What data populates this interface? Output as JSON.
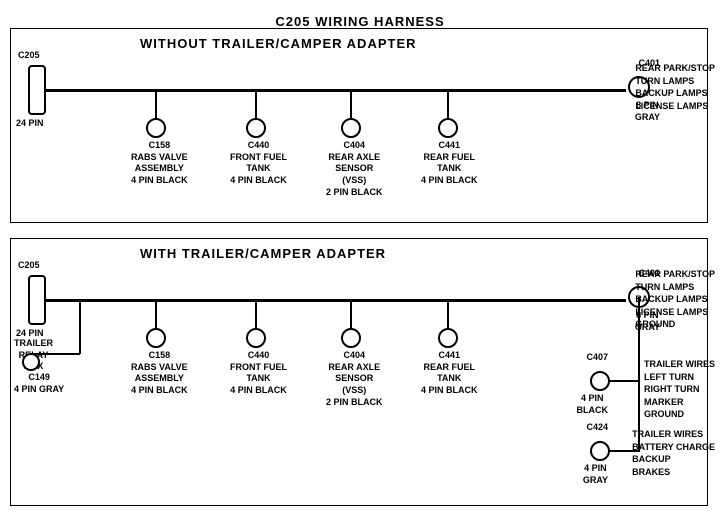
{
  "title": "C205 WIRING HARNESS",
  "section1": {
    "label": "WITHOUT TRAILER/CAMPER ADAPTER",
    "connectors": [
      {
        "id": "C205_1",
        "label": "C205",
        "sub": "24 PIN"
      },
      {
        "id": "C401_1",
        "label": "C401",
        "sub": "8 PIN\nGRAY"
      },
      {
        "id": "C158_1",
        "label": "C158",
        "sub": "RABS VALVE\nASSEMBLY\n4 PIN BLACK"
      },
      {
        "id": "C440_1",
        "label": "C440",
        "sub": "FRONT FUEL\nTANK\n4 PIN BLACK"
      },
      {
        "id": "C404_1",
        "label": "C404",
        "sub": "REAR AXLE\nSENSOR\n(VSS)\n2 PIN BLACK"
      },
      {
        "id": "C441_1",
        "label": "C441",
        "sub": "REAR FUEL\nTANK\n4 PIN BLACK"
      }
    ],
    "right_label": "REAR PARK/STOP\nTURN LAMPS\nBACKUP LAMPS\nLICENSE LAMPS"
  },
  "section2": {
    "label": "WITH TRAILER/CAMPER ADAPTER",
    "connectors": [
      {
        "id": "C205_2",
        "label": "C205",
        "sub": "24 PIN"
      },
      {
        "id": "C401_2",
        "label": "C401",
        "sub": "8 PIN\nGRAY"
      },
      {
        "id": "C158_2",
        "label": "C158",
        "sub": "RABS VALVE\nASSEMBLY\n4 PIN BLACK"
      },
      {
        "id": "C440_2",
        "label": "C440",
        "sub": "FRONT FUEL\nTANK\n4 PIN BLACK"
      },
      {
        "id": "C404_2",
        "label": "C404",
        "sub": "REAR AXLE\nSENSOR\n(VSS)\n2 PIN BLACK"
      },
      {
        "id": "C441_2",
        "label": "C441",
        "sub": "REAR FUEL\nTANK\n4 PIN BLACK"
      },
      {
        "id": "C149",
        "label": "C149",
        "sub": "4 PIN GRAY"
      },
      {
        "id": "C407",
        "label": "C407",
        "sub": "4 PIN\nBLACK"
      },
      {
        "id": "C424",
        "label": "C424",
        "sub": "4 PIN\nGRAY"
      }
    ],
    "right_label1": "REAR PARK/STOP\nTURN LAMPS\nBACKUP LAMPS\nLICENSE LAMPS\nGROUND",
    "right_label2": "TRAILER WIRES\nLEFT TURN\nRIGHT TURN\nMARKER\nGROUND",
    "right_label3": "TRAILER WIRES\nBATTERY CHARGE\nBACKUP\nBRAKES",
    "trailer_relay": "TRAILER\nRELAY\nBOX"
  }
}
